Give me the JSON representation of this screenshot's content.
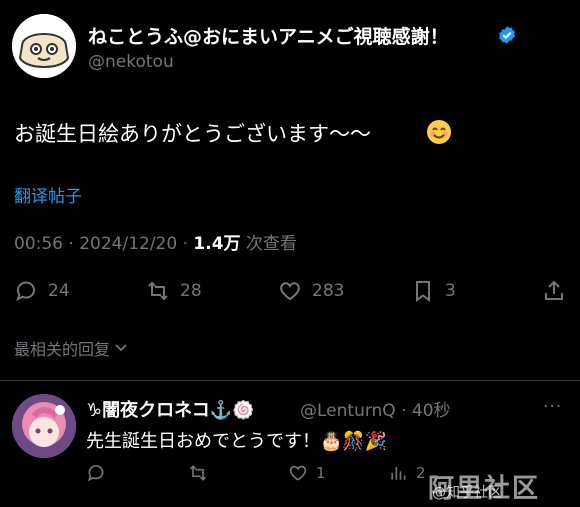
{
  "tweet": {
    "author_name": "ねことうふ@おにまいアニメご視聴感謝！",
    "author_handle": "@nekotou",
    "text": "お誕生日絵ありがとうございます～～",
    "translate_link": "翻译帖子",
    "time": "00:56 · 2024/12/20 · ",
    "views_count": "1.4万",
    "views_label": " 次查看",
    "actions": {
      "replies": "24",
      "retweets": "28",
      "likes": "283",
      "bookmarks": "3"
    },
    "icons": [
      "reply-icon",
      "retweet-icon",
      "like-icon",
      "bookmark-icon",
      "share-icon",
      "verified-badge-icon",
      "smile-emoji-icon"
    ],
    "colors": {
      "background": "#000000",
      "accent": "#1d9bf0",
      "secondary_text": "#71767b"
    }
  },
  "sort": {
    "label": "最相关的回复"
  },
  "reply": {
    "author_name": "♑闇夜クロネコ⚓️🍥",
    "author_handle": "@LenturnQ · 40秒",
    "more": "···",
    "text": "先生誕生日おめでとうです！🎂🎊🎉",
    "actions": {
      "replies": "",
      "retweets": "",
      "likes": "1",
      "views": "2"
    }
  },
  "watermark": {
    "text": "阿里社区",
    "small": "@知乎社区"
  }
}
